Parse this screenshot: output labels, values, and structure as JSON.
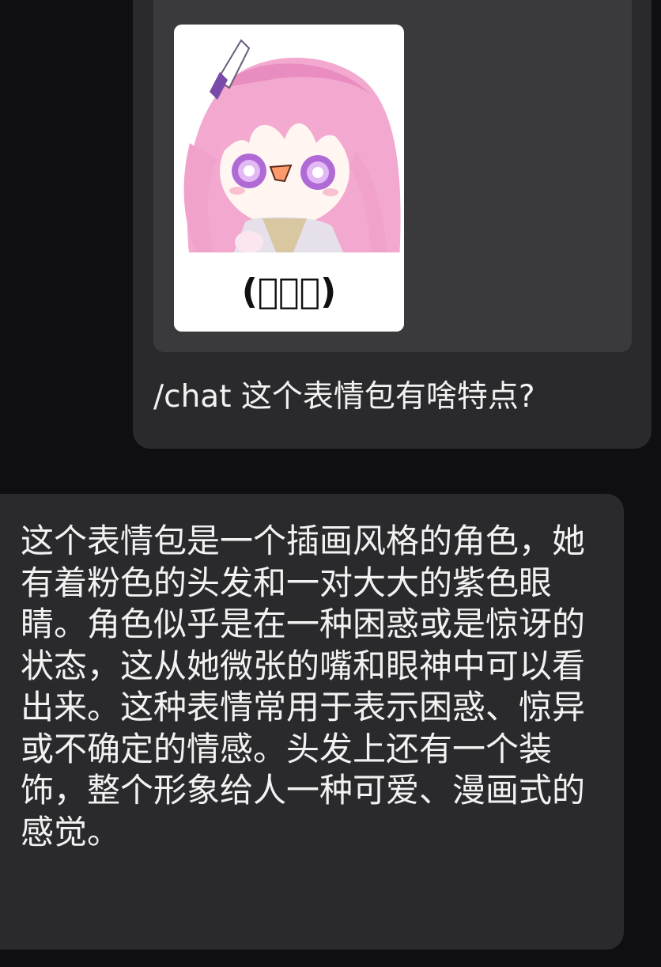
{
  "colors": {
    "background": "#0f0f11",
    "bubble": "#2a2a2d",
    "forward_card": "#3a3a3d",
    "text": "#f2f2f2"
  },
  "outgoing_message": {
    "sticker": {
      "caption": "(ﾟ﹃ﾟ)"
    },
    "text": "/chat 这个表情包有啥特点?"
  },
  "incoming_message": {
    "text": "这个表情包是一个插画风格的角色，她有着粉色的头发和一对大大的紫色眼睛。角色似乎是在一种困惑或是惊讶的状态，这从她微张的嘴和眼神中可以看出来。这种表情常用于表示困惑、惊异或不确定的情感。头发上还有一个装饰，整个形象给人一种可爱、漫画式的感觉。"
  }
}
